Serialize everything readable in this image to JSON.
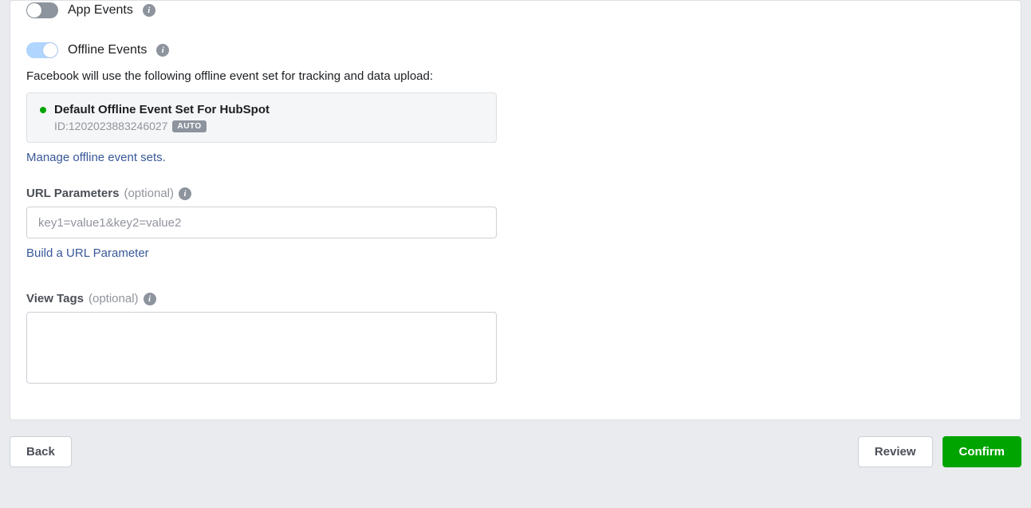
{
  "toggles": {
    "appEvents": {
      "label": "App Events",
      "on": false
    },
    "offlineEvents": {
      "label": "Offline Events",
      "on": true
    }
  },
  "offlineDesc": "Facebook will use the following offline event set for tracking and data upload:",
  "eventSet": {
    "title": "Default Offline Event Set For HubSpot",
    "idLabel": "ID:1202023883246027",
    "badge": "AUTO"
  },
  "links": {
    "manageOffline": "Manage offline event sets.",
    "buildUrl": "Build a URL Parameter"
  },
  "urlParams": {
    "label": "URL Parameters",
    "optional": "(optional)",
    "placeholder": "key1=value1&key2=value2",
    "value": ""
  },
  "viewTags": {
    "label": "View Tags",
    "optional": "(optional)",
    "value": ""
  },
  "buttons": {
    "back": "Back",
    "review": "Review",
    "confirm": "Confirm"
  }
}
